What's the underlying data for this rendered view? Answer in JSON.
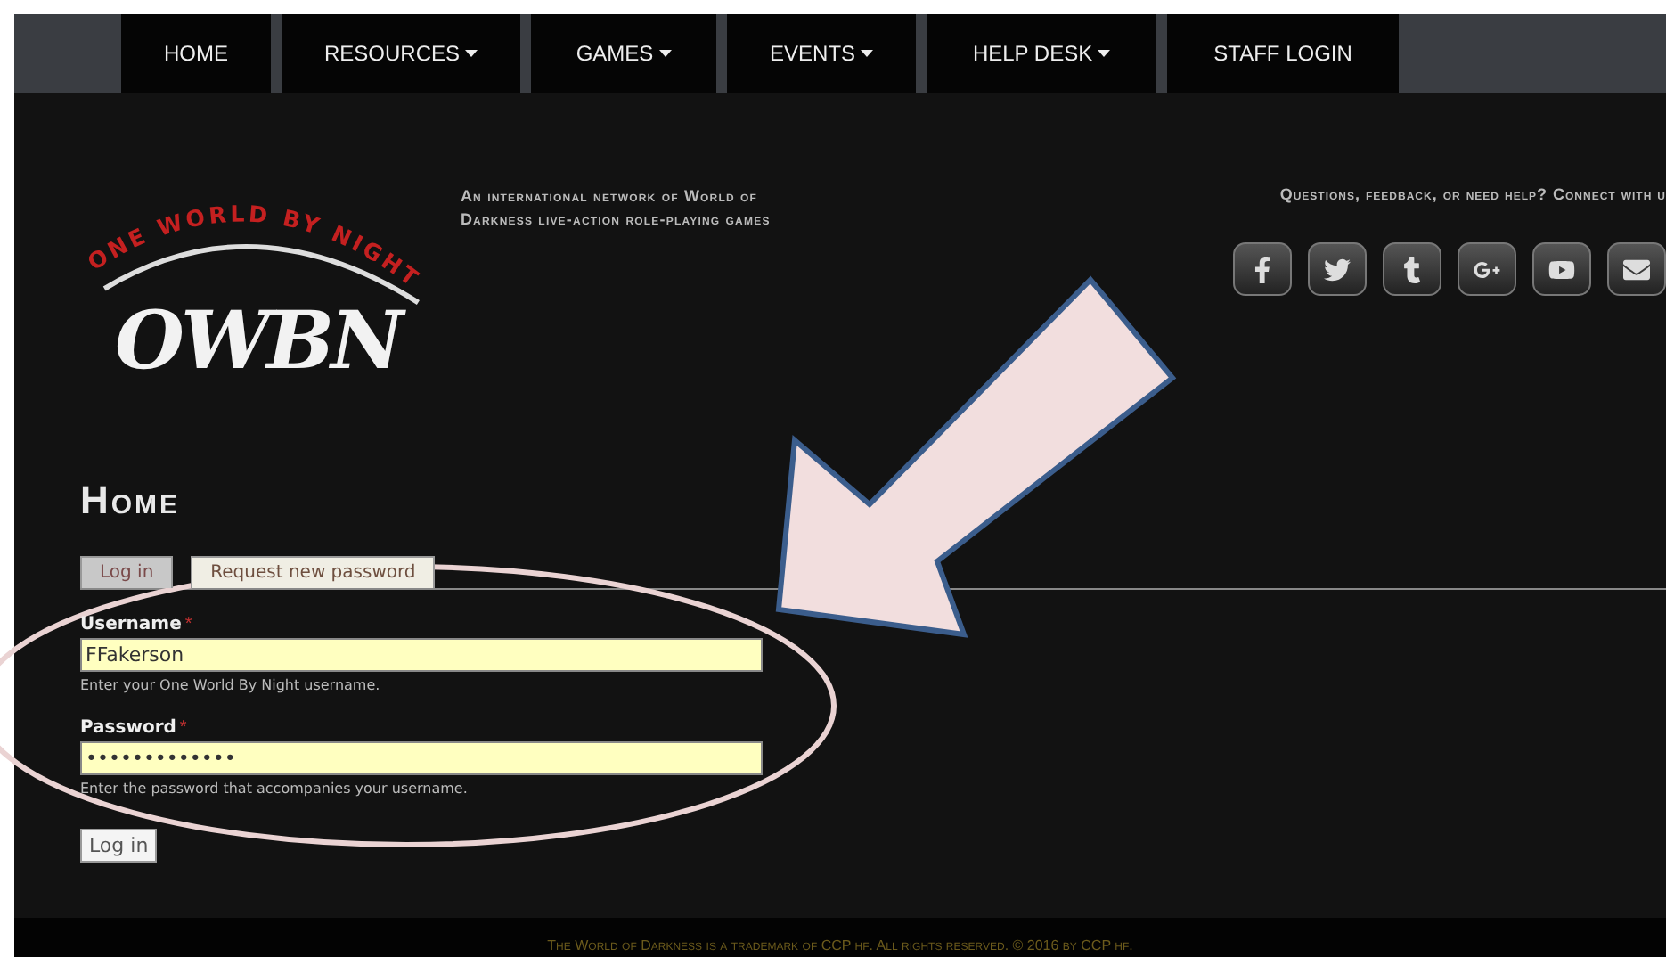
{
  "nav": [
    {
      "label": "HOME",
      "dropdown": false
    },
    {
      "label": "RESOURCES",
      "dropdown": true
    },
    {
      "label": "GAMES",
      "dropdown": true
    },
    {
      "label": "EVENTS",
      "dropdown": true
    },
    {
      "label": "HELP DESK",
      "dropdown": true
    },
    {
      "label": "STAFF LOGIN",
      "dropdown": false
    }
  ],
  "header": {
    "logo": {
      "arc_text": "ONE WORLD BY NIGHT",
      "mark": "OWBN"
    },
    "tagline": "An international network of World of Darkness live-action role-playing games",
    "connect_text": "Questions, feedback, or need help? Connect with u",
    "social": [
      {
        "kind": "facebook"
      },
      {
        "kind": "twitter"
      },
      {
        "kind": "tumblr"
      },
      {
        "kind": "googleplus"
      },
      {
        "kind": "youtube"
      },
      {
        "kind": "email"
      }
    ]
  },
  "page_title": "Home",
  "tabs": [
    {
      "label": "Log in",
      "selected": true
    },
    {
      "label": "Request new password",
      "selected": false
    }
  ],
  "fields": [
    {
      "label": "Username",
      "required_mark": "*",
      "value": "FFakerson",
      "help": "Enter your One World By Night username."
    },
    {
      "label": "Password",
      "required_mark": "*",
      "value": "•••••••••••••",
      "help": "Enter the password that accompanies your username."
    }
  ],
  "submit": "Log in",
  "footer": "The World of Darkness is a trademark of CCP hf. All rights reserved. © 2016 by CCP hf."
}
